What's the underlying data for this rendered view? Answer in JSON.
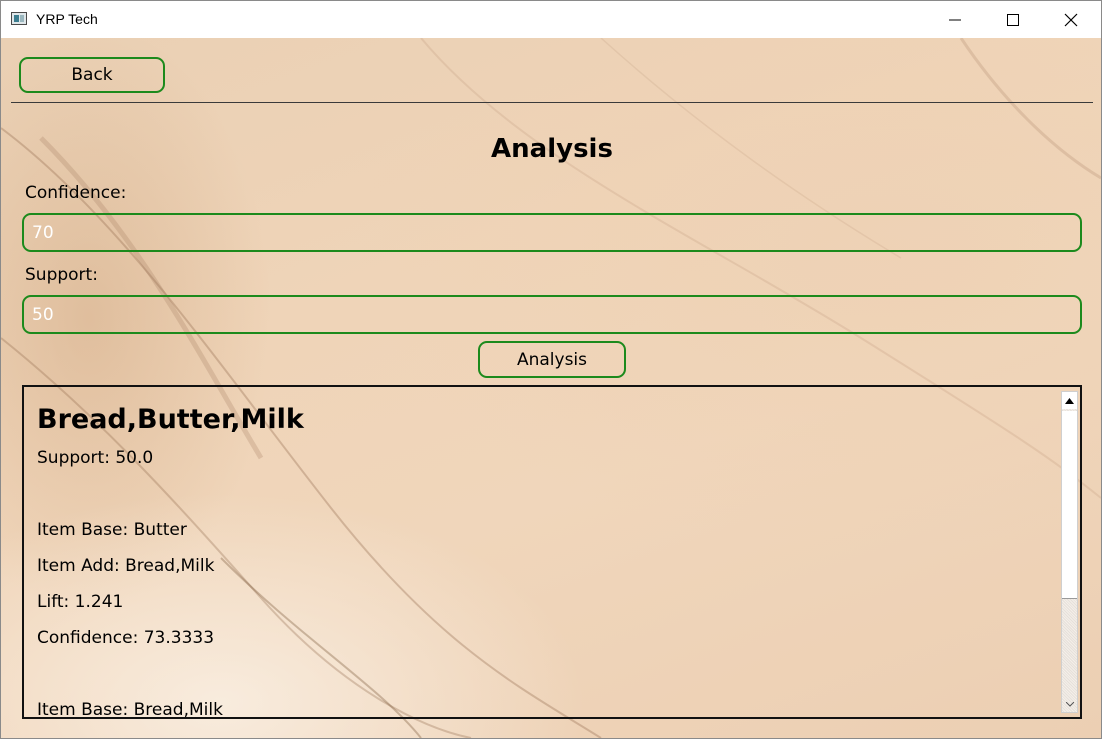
{
  "window": {
    "title": "YRP Tech"
  },
  "nav": {
    "back_label": "Back"
  },
  "page": {
    "title": "Analysis"
  },
  "form": {
    "confidence_label": "Confidence:",
    "confidence_value": "70",
    "support_label": "Support:",
    "support_value": "50",
    "analysis_button_label": "Analysis"
  },
  "results": {
    "heading": "Bread,Butter,Milk",
    "support_line": "Support: 50.0",
    "rules": [
      {
        "item_base": "Item Base: Butter",
        "item_add": "Item Add: Bread,Milk",
        "lift": "Lift: 1.241",
        "confidence": "Confidence: 73.3333"
      },
      {
        "item_base": "Item Base: Bread,Milk"
      }
    ]
  },
  "colors": {
    "accent_border": "#1c8a1c",
    "input_text": "#ffffff",
    "background": "#efd4b8"
  },
  "icons": {
    "app": "app-window-icon",
    "minimize": "minimize-icon",
    "maximize": "maximize-icon",
    "close": "close-icon",
    "scroll_up": "arrow-up-icon",
    "scroll_down": "arrow-down-icon"
  }
}
